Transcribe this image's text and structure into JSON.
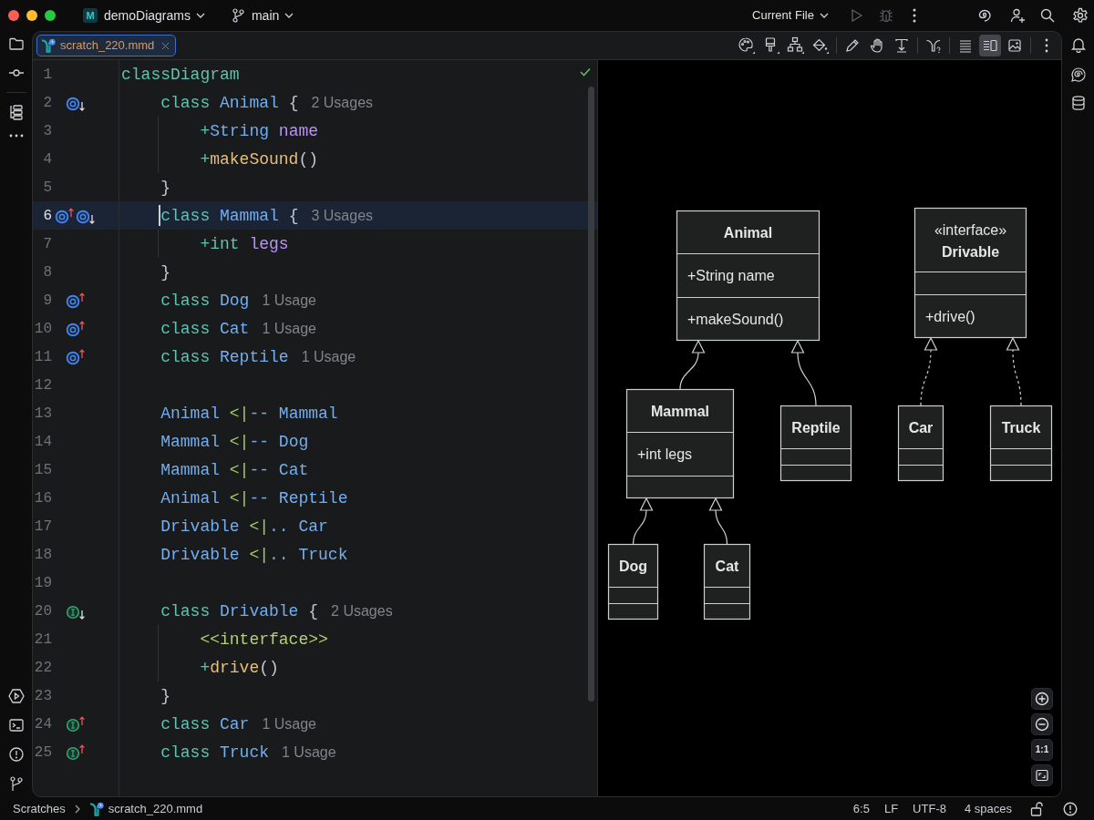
{
  "title_bar": {
    "project": {
      "badge": "M",
      "name": "demoDiagrams"
    },
    "branch": "main",
    "run_configuration": "Current File"
  },
  "tabs": [
    {
      "label": "scratch_220.mmd",
      "selected": true
    }
  ],
  "view_modes": [
    {
      "kind": "editor",
      "selected": false
    },
    {
      "kind": "split",
      "selected": true
    },
    {
      "kind": "preview",
      "selected": false
    }
  ],
  "editor": {
    "lines": [
      {
        "number": "1",
        "current": false,
        "tokens": [
          {
            "kind": "keyword",
            "text": "classDiagram"
          }
        ],
        "children": [
          {
            "number": "2",
            "current": false,
            "gutter": [
              {
                "kind": "class-down"
              }
            ],
            "tokens": [
              {
                "kind": "keyword",
                "text": "class "
              },
              {
                "kind": "type",
                "text": "Animal "
              },
              {
                "kind": "punct",
                "text": "{"
              }
            ],
            "hint": "2 Usages",
            "children": [
              {
                "number": "3",
                "current": false,
                "tokens": [
                  {
                    "kind": "operator",
                    "text": "+"
                  },
                  {
                    "kind": "type",
                    "text": "String "
                  },
                  {
                    "kind": "field",
                    "text": "name"
                  }
                ]
              },
              {
                "number": "4",
                "current": false,
                "tokens": [
                  {
                    "kind": "operator",
                    "text": "+"
                  },
                  {
                    "kind": "function",
                    "text": "makeSound"
                  },
                  {
                    "kind": "punct",
                    "text": "()"
                  }
                ]
              }
            ]
          },
          {
            "number": "5",
            "current": false,
            "tokens": [
              {
                "kind": "punct",
                "text": "}"
              }
            ]
          },
          {
            "number": "6",
            "current": true,
            "gutter": [
              {
                "kind": "class-up"
              },
              {
                "kind": "class-down"
              }
            ],
            "tokens": [
              {
                "kind": "keyword",
                "text": "class "
              },
              {
                "kind": "type",
                "text": "Mammal "
              },
              {
                "kind": "punct",
                "text": "{"
              }
            ],
            "hint": "3 Usages",
            "children": [
              {
                "number": "7",
                "current": false,
                "tokens": [
                  {
                    "kind": "operator",
                    "text": "+"
                  },
                  {
                    "kind": "keyword",
                    "text": "int "
                  },
                  {
                    "kind": "field",
                    "text": "legs"
                  }
                ]
              }
            ]
          },
          {
            "number": "8",
            "current": false,
            "tokens": [
              {
                "kind": "punct",
                "text": "}"
              }
            ]
          },
          {
            "number": "9",
            "current": false,
            "gutter": [
              {
                "kind": "class-up"
              }
            ],
            "tokens": [
              {
                "kind": "keyword",
                "text": "class "
              },
              {
                "kind": "type",
                "text": "Dog"
              }
            ],
            "hint": "1 Usage"
          },
          {
            "number": "10",
            "current": false,
            "gutter": [
              {
                "kind": "class-up"
              }
            ],
            "tokens": [
              {
                "kind": "keyword",
                "text": "class "
              },
              {
                "kind": "type",
                "text": "Cat"
              }
            ],
            "hint": "1 Usage"
          },
          {
            "number": "11",
            "current": false,
            "gutter": [
              {
                "kind": "class-up"
              }
            ],
            "tokens": [
              {
                "kind": "keyword",
                "text": "class "
              },
              {
                "kind": "type",
                "text": "Reptile"
              }
            ],
            "hint": "1 Usage"
          },
          {
            "number": "12",
            "current": false
          },
          {
            "number": "13",
            "current": false,
            "tokens": [
              {
                "kind": "type",
                "text": "Animal "
              },
              {
                "kind": "arrow",
                "text": "<|"
              },
              {
                "kind": "link",
                "text": "-- "
              },
              {
                "kind": "type",
                "text": "Mammal"
              }
            ]
          },
          {
            "number": "14",
            "current": false,
            "tokens": [
              {
                "kind": "type",
                "text": "Mammal "
              },
              {
                "kind": "arrow",
                "text": "<|"
              },
              {
                "kind": "link",
                "text": "-- "
              },
              {
                "kind": "type",
                "text": "Dog"
              }
            ]
          },
          {
            "number": "15",
            "current": false,
            "tokens": [
              {
                "kind": "type",
                "text": "Mammal "
              },
              {
                "kind": "arrow",
                "text": "<|"
              },
              {
                "kind": "link",
                "text": "-- "
              },
              {
                "kind": "type",
                "text": "Cat"
              }
            ]
          },
          {
            "number": "16",
            "current": false,
            "tokens": [
              {
                "kind": "type",
                "text": "Animal "
              },
              {
                "kind": "arrow",
                "text": "<|"
              },
              {
                "kind": "link",
                "text": "-- "
              },
              {
                "kind": "type",
                "text": "Reptile"
              }
            ]
          },
          {
            "number": "17",
            "current": false,
            "tokens": [
              {
                "kind": "type",
                "text": "Drivable "
              },
              {
                "kind": "arrow",
                "text": "<|"
              },
              {
                "kind": "link",
                "text": ".. "
              },
              {
                "kind": "type",
                "text": "Car"
              }
            ]
          },
          {
            "number": "18",
            "current": false,
            "tokens": [
              {
                "kind": "type",
                "text": "Drivable "
              },
              {
                "kind": "arrow",
                "text": "<|"
              },
              {
                "kind": "link",
                "text": ".. "
              },
              {
                "kind": "type",
                "text": "Truck"
              }
            ]
          },
          {
            "number": "19",
            "current": false
          },
          {
            "number": "20",
            "current": false,
            "gutter": [
              {
                "kind": "interface-down"
              }
            ],
            "tokens": [
              {
                "kind": "keyword",
                "text": "class "
              },
              {
                "kind": "type",
                "text": "Drivable "
              },
              {
                "kind": "punct",
                "text": "{"
              }
            ],
            "hint": "2 Usages",
            "children": [
              {
                "number": "21",
                "current": false,
                "tokens": [
                  {
                    "kind": "annotation",
                    "text": "<<interface>>"
                  }
                ]
              },
              {
                "number": "22",
                "current": false,
                "tokens": [
                  {
                    "kind": "operator",
                    "text": "+"
                  },
                  {
                    "kind": "function",
                    "text": "drive"
                  },
                  {
                    "kind": "punct",
                    "text": "()"
                  }
                ]
              }
            ]
          },
          {
            "number": "23",
            "current": false,
            "tokens": [
              {
                "kind": "punct",
                "text": "}"
              }
            ]
          },
          {
            "number": "24",
            "current": false,
            "gutter": [
              {
                "kind": "interface-up"
              }
            ],
            "tokens": [
              {
                "kind": "keyword",
                "text": "class "
              },
              {
                "kind": "type",
                "text": "Car"
              }
            ],
            "hint": "1 Usage"
          },
          {
            "number": "25",
            "current": false,
            "gutter": [
              {
                "kind": "interface-up"
              }
            ],
            "tokens": [
              {
                "kind": "keyword",
                "text": "class "
              },
              {
                "kind": "type",
                "text": "Truck"
              }
            ],
            "hint": "1 Usage"
          }
        ]
      }
    ]
  },
  "diagram": {
    "classes": [
      {
        "name": "Animal",
        "attributes": [
          "+String name"
        ],
        "methods": [
          "+makeSound()"
        ],
        "children": [
          {
            "name": "Mammal",
            "kind": "inheritance",
            "attributes": [
              "+int legs"
            ],
            "children": [
              {
                "name": "Dog",
                "kind": "inheritance"
              },
              {
                "name": "Cat",
                "kind": "inheritance"
              }
            ]
          },
          {
            "name": "Reptile",
            "kind": "inheritance"
          }
        ]
      },
      {
        "name": "Drivable",
        "stereotype": "«interface»",
        "methods": [
          "+drive()"
        ],
        "children": [
          {
            "name": "Car",
            "kind": "realization"
          },
          {
            "name": "Truck",
            "kind": "realization"
          }
        ]
      }
    ]
  },
  "zoom_controls": {
    "actual_size": "1:1"
  },
  "status_bar": {
    "breadcrumbs": [
      {
        "kind": "folder",
        "label": "Scratches"
      },
      {
        "kind": "file",
        "label": "scratch_220.mmd"
      }
    ],
    "caret_position": "6:5",
    "line_separator": "LF",
    "encoding": "UTF-8",
    "indent": "4 spaces"
  }
}
